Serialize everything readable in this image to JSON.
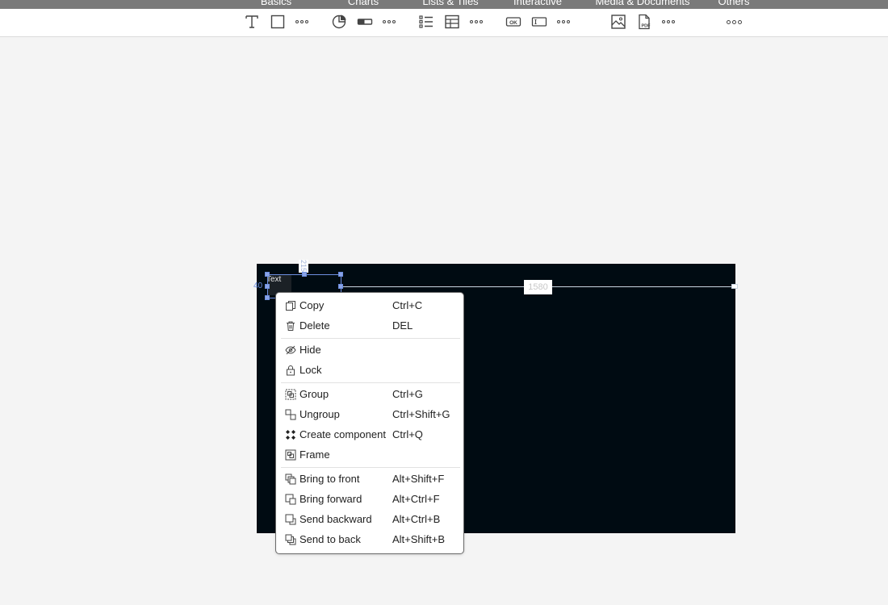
{
  "categories": [
    "Basics",
    "Charts",
    "Lists & Tiles",
    "Interactive",
    "Media & Documents",
    "Others"
  ],
  "toolbar": {
    "tools": [
      "text-tool-icon",
      "rectangle-tool-icon",
      "pie-chart-tool-icon",
      "progress-bar-tool-icon",
      "list-tool-icon",
      "table-tool-icon",
      "ok-button-tool-icon",
      "input-field-tool-icon",
      "image-tool-icon",
      "pdf-tool-icon"
    ]
  },
  "canvas": {
    "frame_color": "#000b12",
    "text_element_label": "Text",
    "width_label": "1580",
    "left_label": "40",
    "top_label": "215"
  },
  "context_menu": {
    "items": [
      {
        "label": "Copy",
        "shortcut": "Ctrl+C",
        "icon": "copy-icon"
      },
      {
        "label": "Delete",
        "shortcut": "DEL",
        "icon": "trash-icon"
      },
      {
        "label": "Hide",
        "shortcut": "",
        "icon": "eye-off-icon"
      },
      {
        "label": "Lock",
        "shortcut": "",
        "icon": "lock-icon"
      },
      {
        "label": "Group",
        "shortcut": "Ctrl+G",
        "icon": "group-icon"
      },
      {
        "label": "Ungroup",
        "shortcut": "Ctrl+Shift+G",
        "icon": "ungroup-icon"
      },
      {
        "label": "Create component",
        "shortcut": "Ctrl+Q",
        "icon": "component-icon"
      },
      {
        "label": "Frame",
        "shortcut": "",
        "icon": "frame-icon"
      },
      {
        "label": "Bring to front",
        "shortcut": "Alt+Shift+F",
        "icon": "bring-to-front-icon"
      },
      {
        "label": "Bring forward",
        "shortcut": "Alt+Ctrl+F",
        "icon": "bring-forward-icon"
      },
      {
        "label": "Send backward",
        "shortcut": "Alt+Ctrl+B",
        "icon": "send-backward-icon"
      },
      {
        "label": "Send to back",
        "shortcut": "Alt+Shift+B",
        "icon": "send-to-back-icon"
      }
    ]
  }
}
